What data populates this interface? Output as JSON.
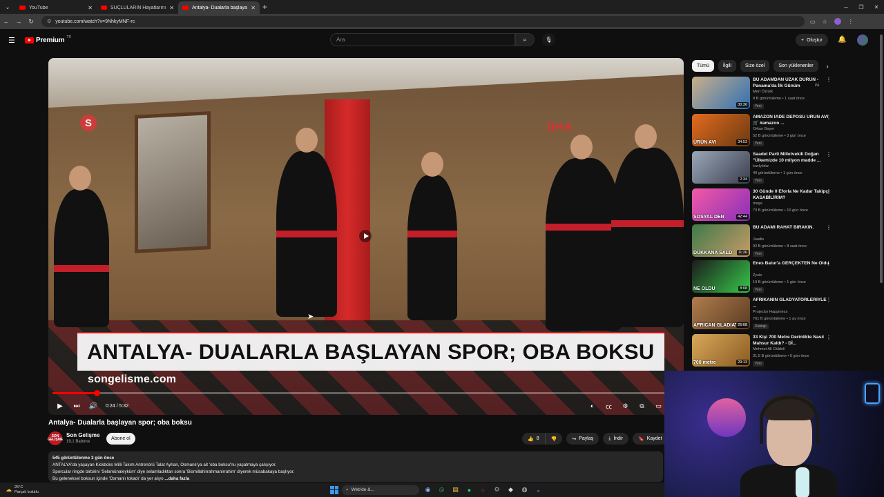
{
  "browser": {
    "tabs": [
      {
        "label": "YouTube",
        "active": false
      },
      {
        "label": "SUÇLULARIN Hayatlarını MAHV",
        "active": false
      },
      {
        "label": "Antalya- Dualarla başlayan spo",
        "active": true
      }
    ],
    "url": "youtube.com/watch?v=9NhkyMNF-rc"
  },
  "header": {
    "logo_text": "Premium",
    "logo_sup": "TR",
    "search_placeholder": "Ara",
    "create_label": "Oluştur"
  },
  "player": {
    "caption": "ANTALYA- DUALARLA BAŞLAYAN SPOR; OBA BOKSU",
    "site": "songelisme.com",
    "watermark_s": "S",
    "watermark_dha": "DHA",
    "time": "0:24 / 5:32",
    "progress": 0.072
  },
  "video": {
    "title": "Antalya- Dualarla başlayan spor; oba boksu",
    "channel": "Son Gelişme",
    "channel_avatar_text": "SON GELİŞME",
    "subscribers": "19,1 Babone",
    "subscribe_label": "Abone ol",
    "likes": "8",
    "share_label": "Paylaş",
    "download_label": "İndir",
    "save_label": "Kaydet"
  },
  "description": {
    "views_line": "545 görüntülenme  3 gün önce",
    "lines": [
      "ANTALYA'da yaşayan Kickboks Milli Takım Antrenörü Talat Ayhan, Osmanlı'ya ait 'oba boksu'nu yaşatmaya çalışıyor.",
      "Sporcular ringde birbirini 'Selamünaleyküm' diye selamladıktan sonra 'Bismillahirrahmanirrahim' diyerek müsabakaya başlıyor.",
      "Bu geleneksel boksun içinde 'Osmanlı tokadı' da yer alıyo"
    ],
    "more": "...daha fazla"
  },
  "sidebar": {
    "chips": [
      "Tümü",
      "İlgili",
      "Size özel",
      "Son yüklenenler"
    ],
    "items": [
      {
        "title": "BU ADAMDAN UZAK DURUN - Panama'da İlk Günüm",
        "title_suffix": "PA",
        "channel": "Mert Öztürk",
        "meta": "8 B görüntüleme • 1 saat önce",
        "badge": "Yeni",
        "duration": "30:36",
        "thumb_colors": [
          "#c9b08a",
          "#2f6fb3"
        ],
        "thumb_text": ""
      },
      {
        "title": "AMAZON İADE DEPOSU ÜRÜN AVI 🛒 #amazon ...",
        "channel": "Orkun Bayer",
        "meta": "52 B görüntüleme • 3 gün önce",
        "badge": "Yeni",
        "duration": "34:53",
        "thumb_colors": [
          "#e36b1e",
          "#6b3a12"
        ],
        "thumb_text": "ÜRÜN AVI"
      },
      {
        "title": "Saadet Parti Milletvekili Doğan \"Ülkemizde 10 milyon madde ...",
        "channel": "kızılyıldız",
        "meta": "40 görüntüleme • 1 gün önce",
        "badge": "Yeni",
        "duration": "2:34",
        "thumb_colors": [
          "#9aa7b8",
          "#3b3f4f"
        ],
        "thumb_text": ""
      },
      {
        "title": "30 Günde 0 Eforla Ne Kadar Takipçi KASABİLİRİM?",
        "channel": "maşa",
        "meta": "73 B görüntüleme • 10 gün önce",
        "badge": "",
        "duration": "42:44",
        "thumb_colors": [
          "#f25aa6",
          "#8a2fb8"
        ],
        "thumb_text": "SOSYAL DEN"
      },
      {
        "title": "BU ADAMI RAHAT BIRAKIN.",
        "channel": "Juadis",
        "meta": "92 B görüntüleme • 8 saat önce",
        "badge": "Yeni",
        "duration": "11:26",
        "thumb_colors": [
          "#3f7a4a",
          "#c89b67"
        ],
        "thumb_text": "DÜKKANA SALD"
      },
      {
        "title": "Enes Batur'a GERÇEKTEN Ne Oldu",
        "channel": "Zyxie",
        "meta": "10 B görüntüleme • 1 gün önce",
        "badge": "Yeni",
        "duration": "8:08",
        "thumb_colors": [
          "#1c1c1c",
          "#37c84a"
        ],
        "thumb_text": "NE OLDU"
      },
      {
        "title": "AFRİKANIN GLADYATÖRLERİYLE ...",
        "channel": "Projector Happiness",
        "meta": "761 B görüntüleme • 1 ay önce",
        "badge": "Dublajlı",
        "duration": "26:08",
        "thumb_colors": [
          "#b07d4d",
          "#5a3b22"
        ],
        "thumb_text": "AFRICAN GLADIATORS"
      },
      {
        "title": "33 Kişi 700 Metre Derinlikte Nasıl Mahsur Kaldı? - Dİ...",
        "channel": "Mehmet Ali Güldeli",
        "meta": "31,5 B görüntüleme • 5 gün önce",
        "badge": "Yeni",
        "duration": "29:13",
        "thumb_colors": [
          "#d8a95a",
          "#8a5a22"
        ],
        "thumb_text": "700 metre"
      }
    ]
  },
  "taskbar": {
    "temp": "25°C",
    "weather_desc": "Parçalı bulutlu",
    "search_label": "Web'de &..."
  }
}
